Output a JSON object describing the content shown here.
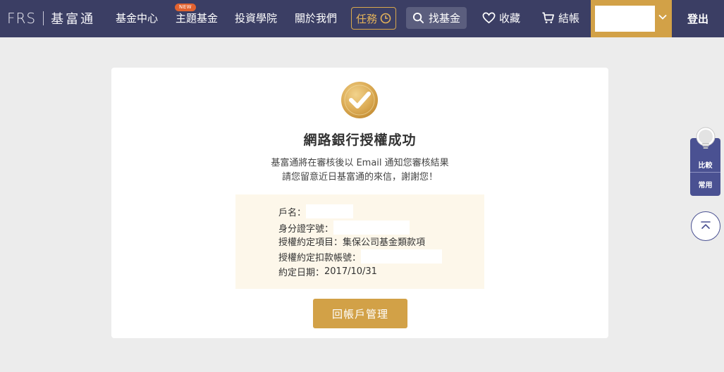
{
  "header": {
    "logo_text": "FRS",
    "brand": "基富通",
    "nav": [
      "基金中心",
      "主題基金",
      "投資學院",
      "關於我們"
    ],
    "new_badge": "NEW",
    "task_label": "任務",
    "search_label": "找基金",
    "favorites_label": "收藏",
    "checkout_label": "結帳",
    "logout_label": "登出",
    "accent_color": "#d2a147",
    "bg_color": "#3b3e64"
  },
  "card": {
    "title": "網路銀行授權成功",
    "desc_line1": "基富通將在審核後以 Email 通知您審核結果",
    "desc_line2": "請您留意近日基富通的來信，謝謝您！",
    "info": {
      "account_name_label": "戶名：",
      "id_number_label": "身分證字號：",
      "auth_item_label": "授權約定項目：",
      "auth_item_value": "集保公司基金類款項",
      "debit_account_label": "授權約定扣款帳號：",
      "date_label": "約定日期：",
      "date_value": "2017/10/31"
    },
    "back_button": "回帳戶管理"
  },
  "side": {
    "compare_label": "比較",
    "common_label": "常用"
  }
}
